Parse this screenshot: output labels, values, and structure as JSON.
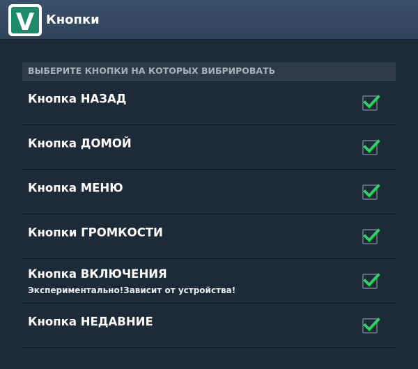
{
  "app": {
    "title": "Кнопки",
    "logo_icon": "app-logo-v-icon",
    "logo_letter": "V",
    "accent_color": "#2ad25f"
  },
  "section": {
    "header": "ВЫБЕРИТЕ КНОПКИ НА КОТОРЫХ ВИБРИРОВАТЬ"
  },
  "items": [
    {
      "title": "Кнопка НАЗАД",
      "subtitle": "",
      "checked": true
    },
    {
      "title": "Кнопка ДОМОЙ",
      "subtitle": "",
      "checked": true
    },
    {
      "title": "Кнопка МЕНЮ",
      "subtitle": "",
      "checked": true
    },
    {
      "title": "Кнопки ГРОМКОСТИ",
      "subtitle": "",
      "checked": true
    },
    {
      "title": "Кнопка ВКЛЮЧЕНИЯ",
      "subtitle": "Экспериментально!Зависит от устройства!",
      "checked": true
    },
    {
      "title": "Кнопка НЕДАВНИЕ",
      "subtitle": "",
      "checked": true
    }
  ]
}
